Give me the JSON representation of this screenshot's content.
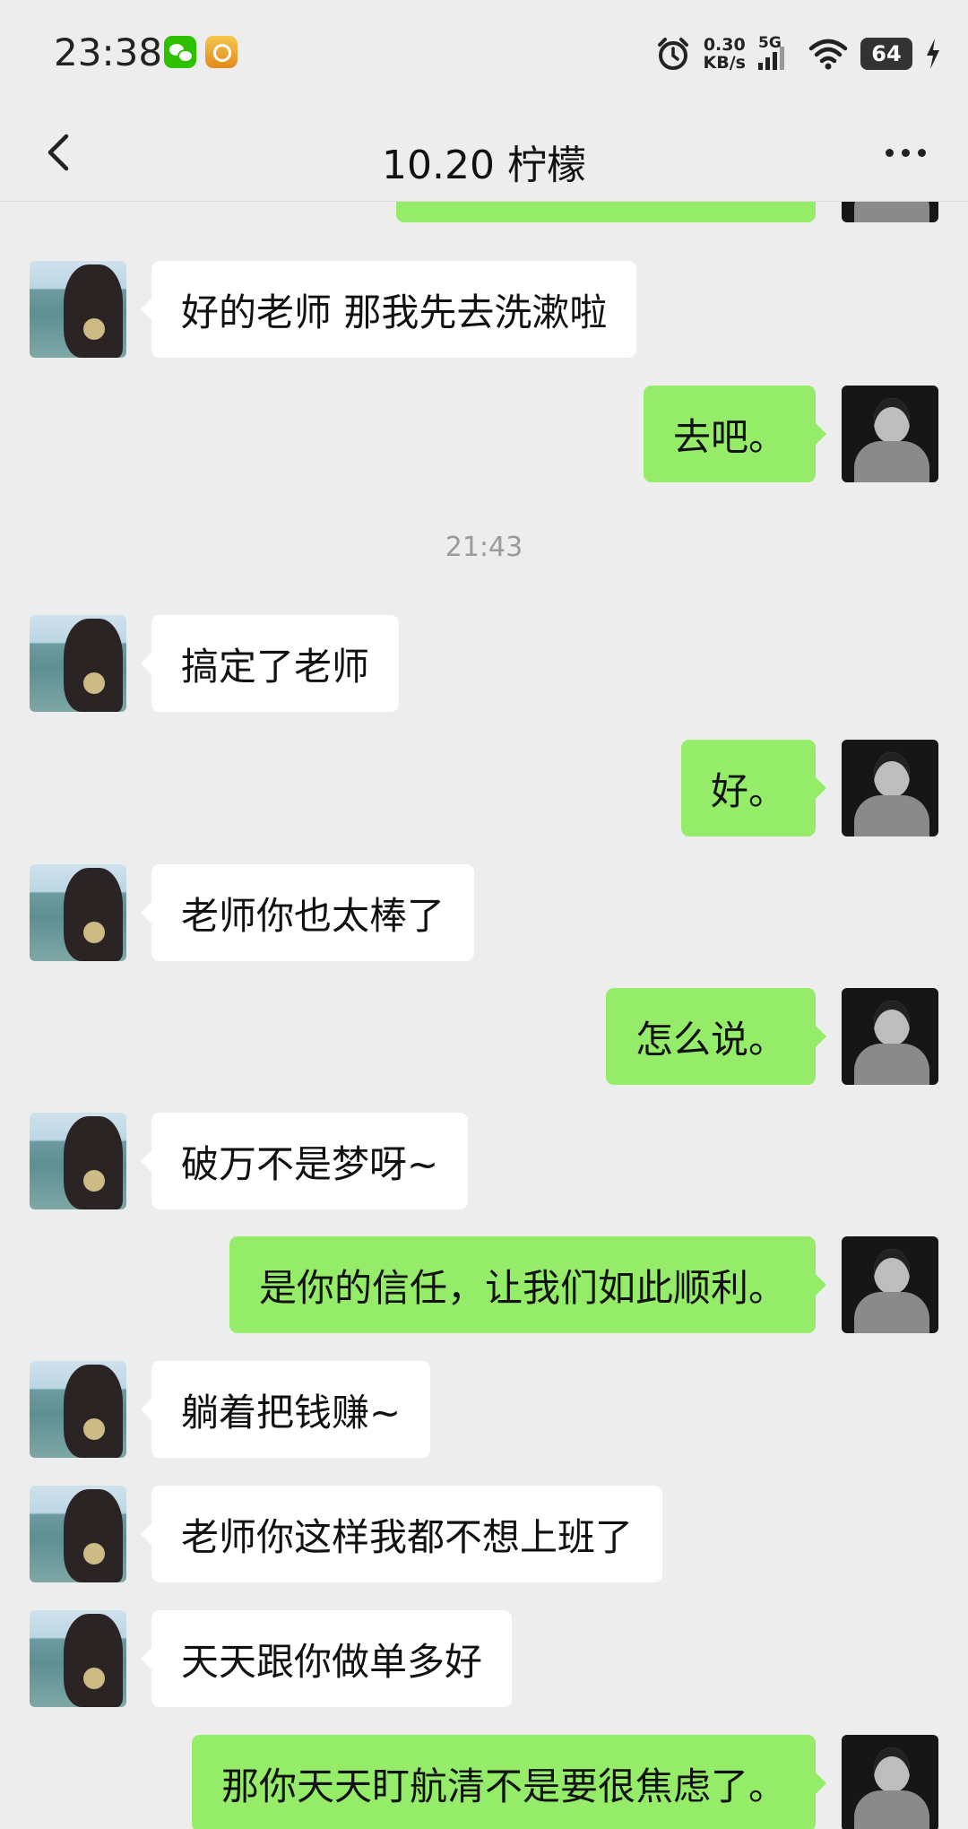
{
  "status_bar": {
    "time": "23:38",
    "net_speed_value": "0.30",
    "net_speed_unit": "KB/s",
    "network": "5G",
    "battery": "64",
    "icons": [
      "wechat-notification-icon",
      "app-notification-icon",
      "alarm-icon",
      "signal-icon",
      "wifi-icon",
      "battery-icon",
      "charging-icon"
    ]
  },
  "header": {
    "title": "10.20 柠檬",
    "back_icon": "chevron-left-icon",
    "more_icon": "more-dots-icon"
  },
  "chat": {
    "partial_top_message": "",
    "timestamp": "21:43",
    "messages": [
      {
        "side": "in",
        "text": "好的老师 那我先去洗漱啦"
      },
      {
        "side": "out",
        "text": "去吧。"
      },
      {
        "side": "in",
        "text": "搞定了老师"
      },
      {
        "side": "out",
        "text": "好。"
      },
      {
        "side": "in",
        "text": "老师你也太棒了"
      },
      {
        "side": "out",
        "text": "怎么说。"
      },
      {
        "side": "in",
        "text": "破万不是梦呀~"
      },
      {
        "side": "out",
        "text": "是你的信任，让我们如此顺利。"
      },
      {
        "side": "in",
        "text": "躺着把钱赚~"
      },
      {
        "side": "in",
        "text": "老师你这样我都不想上班了"
      },
      {
        "side": "in",
        "text": "天天跟你做单多好"
      },
      {
        "side": "out",
        "text": "那你天天盯航清不是要很焦虑了。"
      }
    ]
  },
  "colors": {
    "background": "#ededed",
    "incoming_bubble": "#ffffff",
    "outgoing_bubble": "#95ec69"
  }
}
